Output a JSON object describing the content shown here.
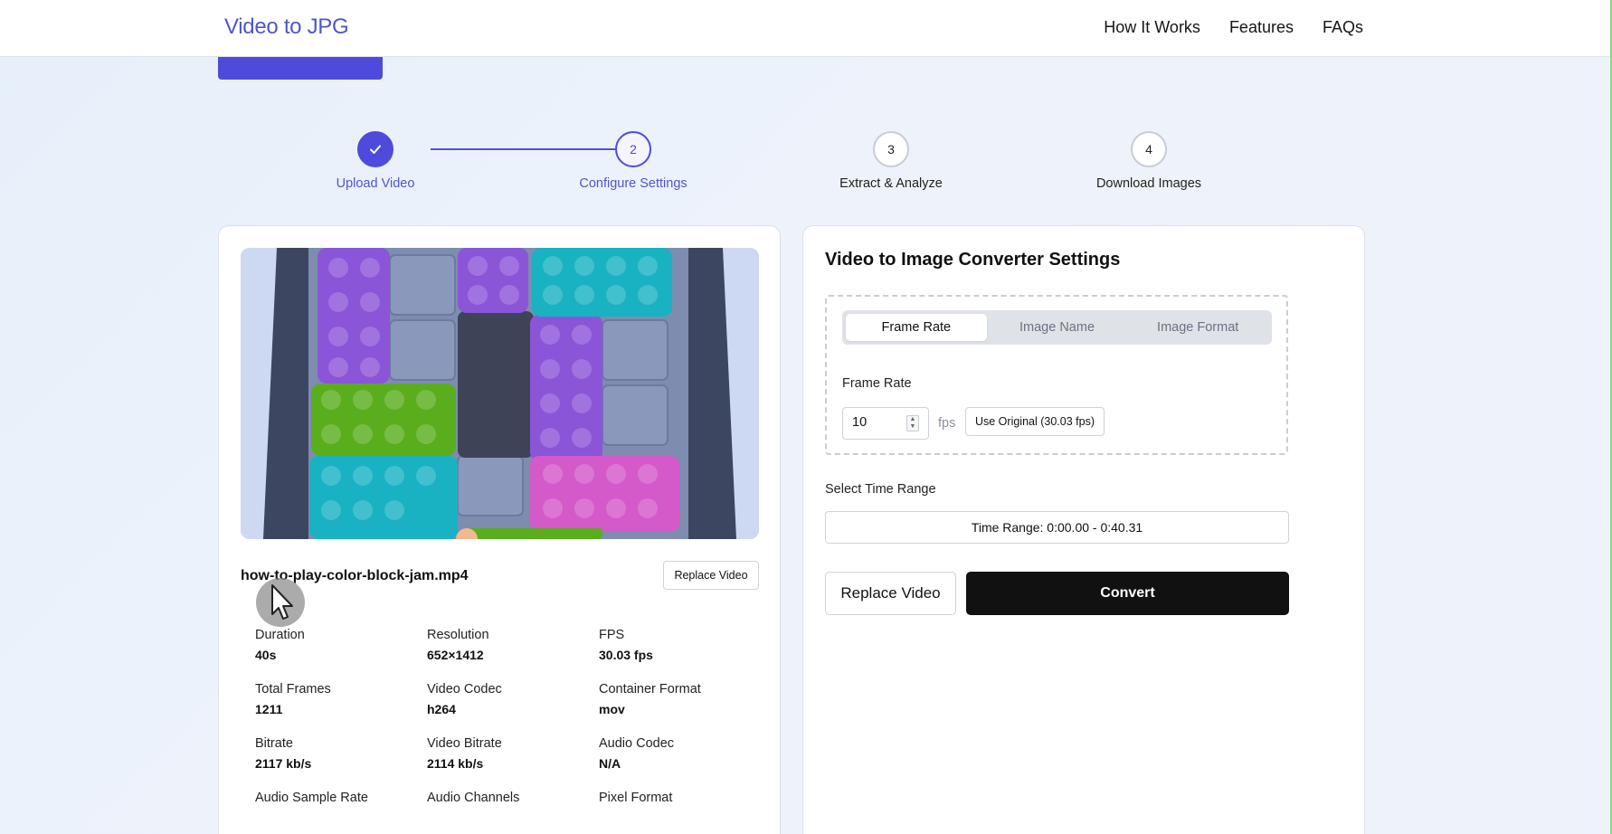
{
  "header": {
    "brand": "Video to JPG",
    "nav": [
      "How It Works",
      "Features",
      "FAQs"
    ]
  },
  "stepper": {
    "steps": [
      {
        "number": "✓",
        "label": "Upload Video",
        "state": "done"
      },
      {
        "number": "2",
        "label": "Configure Settings",
        "state": "active"
      },
      {
        "number": "3",
        "label": "Extract & Analyze",
        "state": "pending"
      },
      {
        "number": "4",
        "label": "Download Images",
        "state": "pending"
      }
    ]
  },
  "video": {
    "filename": "how-to-play-color-block-jam.mp4",
    "replace_label": "Replace Video",
    "metadata": [
      {
        "label": "Duration",
        "value": "40s"
      },
      {
        "label": "Resolution",
        "value": "652×1412"
      },
      {
        "label": "FPS",
        "value": "30.03 fps"
      },
      {
        "label": "Total Frames",
        "value": "1211"
      },
      {
        "label": "Video Codec",
        "value": "h264"
      },
      {
        "label": "Container Format",
        "value": "mov"
      },
      {
        "label": "Bitrate",
        "value": "2117 kb/s"
      },
      {
        "label": "Video Bitrate",
        "value": "2114 kb/s"
      },
      {
        "label": "Audio Codec",
        "value": "N/A"
      },
      {
        "label": "Audio Sample Rate",
        "value": ""
      },
      {
        "label": "Audio Channels",
        "value": ""
      },
      {
        "label": "Pixel Format",
        "value": ""
      }
    ]
  },
  "settings": {
    "title": "Video to Image Converter Settings",
    "tabs": [
      {
        "label": "Frame Rate",
        "active": true
      },
      {
        "label": "Image Name",
        "active": false
      },
      {
        "label": "Image Format",
        "active": false
      }
    ],
    "frame_rate_label": "Frame Rate",
    "frame_rate_value": "10",
    "fps_unit": "fps",
    "use_original_label": "Use Original (30.03 fps)",
    "time_range_label": "Select Time Range",
    "time_range_value": "Time Range: 0:00.00 - 0:40.31",
    "replace_label": "Replace Video",
    "convert_label": "Convert"
  },
  "colors": {
    "accent": "#4e4bdc",
    "brand_text": "#4f56c7",
    "convert_bg": "#111111"
  }
}
